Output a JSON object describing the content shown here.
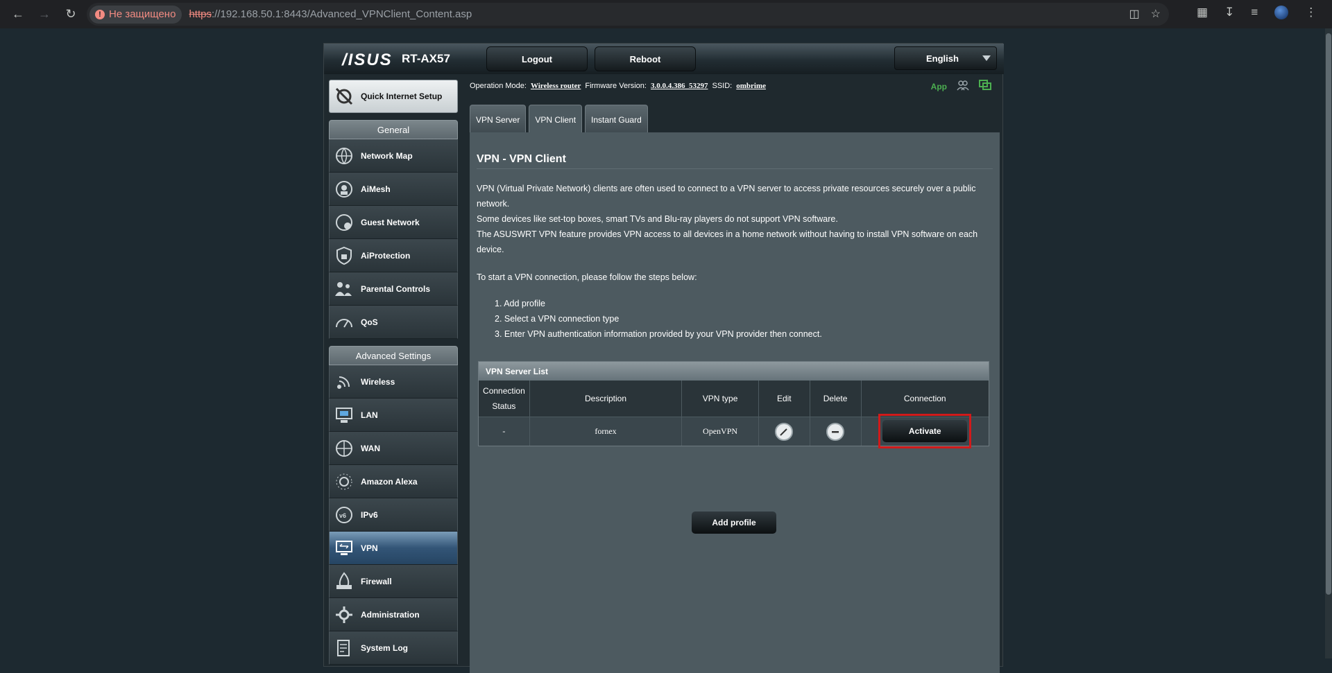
{
  "browser": {
    "insecure_label": "Не защищено",
    "url_scheme": "https",
    "url_rest": "://192.168.50.1:8443/Advanced_VPNClient_Content.asp"
  },
  "header": {
    "logo": "/ISUS",
    "model": "RT-AX57",
    "logout": "Logout",
    "reboot": "Reboot",
    "language": "English"
  },
  "status": {
    "op_mode_label": "Operation Mode:",
    "op_mode_value": "Wireless router",
    "fw_label": "Firmware Version:",
    "fw_value": "3.0.0.4.386_53297",
    "ssid_label": "SSID:",
    "ssid_value": "ombrime",
    "app_label": "App"
  },
  "sidebar": {
    "quick_setup": "Quick Internet Setup",
    "general_title": "General",
    "general_items": [
      {
        "label": "Network Map",
        "icon": "network-map-icon"
      },
      {
        "label": "AiMesh",
        "icon": "aimesh-icon"
      },
      {
        "label": "Guest Network",
        "icon": "guest-network-icon"
      },
      {
        "label": "AiProtection",
        "icon": "aiprotection-icon"
      },
      {
        "label": "Parental Controls",
        "icon": "parental-controls-icon"
      },
      {
        "label": "QoS",
        "icon": "qos-icon"
      }
    ],
    "advanced_title": "Advanced Settings",
    "advanced_items": [
      {
        "label": "Wireless",
        "icon": "wireless-icon"
      },
      {
        "label": "LAN",
        "icon": "lan-icon"
      },
      {
        "label": "WAN",
        "icon": "wan-icon"
      },
      {
        "label": "Amazon Alexa",
        "icon": "alexa-icon"
      },
      {
        "label": "IPv6",
        "icon": "ipv6-icon"
      },
      {
        "label": "VPN",
        "icon": "vpn-icon"
      },
      {
        "label": "Firewall",
        "icon": "firewall-icon"
      },
      {
        "label": "Administration",
        "icon": "administration-icon"
      },
      {
        "label": "System Log",
        "icon": "system-log-icon"
      }
    ]
  },
  "tabs": [
    "VPN Server",
    "VPN Client",
    "Instant Guard"
  ],
  "main": {
    "title": "VPN - VPN Client",
    "desc1": "VPN (Virtual Private Network) clients are often used to connect to a VPN server to access private resources securely over a public network.",
    "desc2": "Some devices like set-top boxes, smart TVs and Blu-ray players do not support VPN software.",
    "desc3": "The ASUSWRT VPN feature provides VPN access to all devices in a home network without having to install VPN software on each device.",
    "steps_intro": "To start a VPN connection, please follow the steps below:",
    "steps": [
      "1. Add profile",
      "2. Select a VPN connection type",
      "3. Enter VPN authentication information provided by your VPN provider then connect."
    ],
    "table_title": "VPN Server List",
    "columns": [
      "Connection Status",
      "Description",
      "VPN type",
      "Edit",
      "Delete",
      "Connection"
    ],
    "row": {
      "status": "-",
      "description": "fornex",
      "vpn_type": "OpenVPN",
      "action": "Activate"
    },
    "add_profile": "Add profile"
  }
}
